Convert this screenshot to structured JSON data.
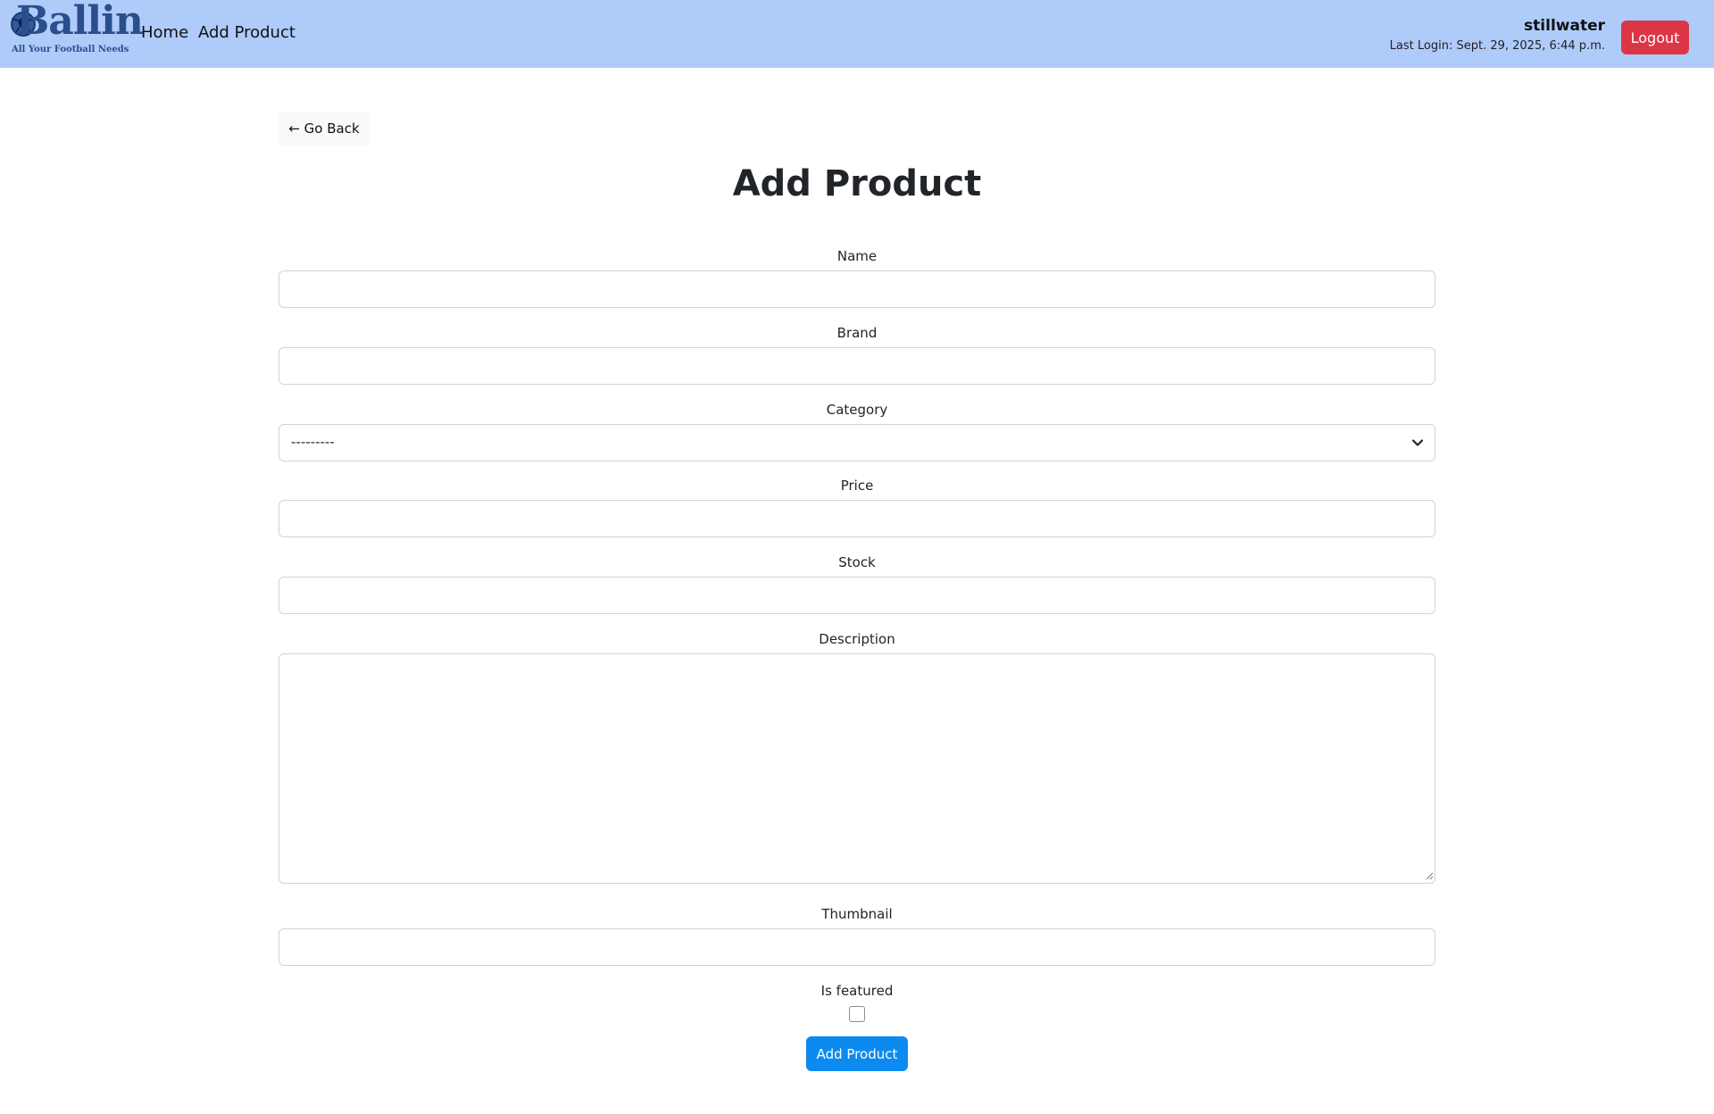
{
  "header": {
    "logo_text": "Ballin",
    "logo_tagline": "All Your Football Needs",
    "nav": [
      {
        "label": "Home"
      },
      {
        "label": "Add Product"
      }
    ],
    "username": "stillwater",
    "last_login": "Last Login: Sept. 29, 2025, 6:44 p.m.",
    "logout_label": "Logout"
  },
  "page": {
    "back_label": "← Go Back",
    "title": "Add Product"
  },
  "form": {
    "name_label": "Name",
    "name_value": "",
    "brand_label": "Brand",
    "brand_value": "",
    "category_label": "Category",
    "category_selected": "---------",
    "price_label": "Price",
    "price_value": "",
    "stock_label": "Stock",
    "stock_value": "",
    "description_label": "Description",
    "description_value": "",
    "thumbnail_label": "Thumbnail",
    "thumbnail_value": "",
    "featured_label": "Is featured",
    "featured_checked": false,
    "submit_label": "Add Product"
  },
  "colors": {
    "navbar": "#aecbfa",
    "logout": "#dc3545",
    "primary": "#0d8af0",
    "logo": "#2a4f8c"
  },
  "icons": {
    "logo": "football-icon",
    "select": "chevron-down-icon",
    "textarea": "resize-grip-icon",
    "checkbox": "checkbox-icon"
  }
}
